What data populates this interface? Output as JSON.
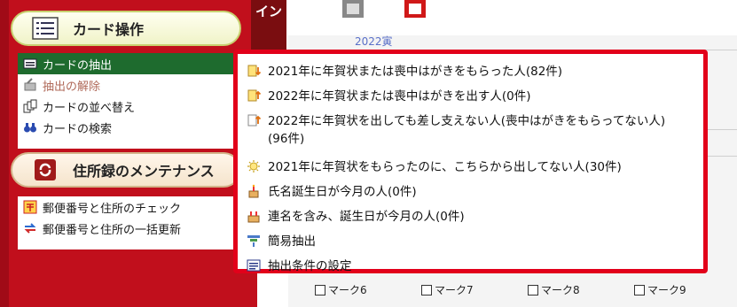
{
  "sidebar": {
    "vertical_tab": "イン",
    "card_ops": {
      "title": "カード操作",
      "items": [
        {
          "label": "カードの抽出"
        },
        {
          "label": "抽出の解除"
        },
        {
          "label": "カードの並べ替え"
        },
        {
          "label": "カードの検索"
        }
      ]
    },
    "maintenance": {
      "title": "住所録のメンテナンス",
      "items": [
        {
          "label": "郵便番号と住所のチェック"
        },
        {
          "label": "郵便番号と住所の一括更新"
        }
      ]
    }
  },
  "main": {
    "year_label": "2022寅",
    "marks": [
      "マーク6",
      "マーク7",
      "マーク8",
      "マーク9"
    ]
  },
  "popup": {
    "items": [
      {
        "label": "2021年に年賀状または喪中はがきをもらった人(82件)",
        "icon": "card-arrow-down-icon"
      },
      {
        "label": "2022年に年賀状または喪中はがきを出す人(0件)",
        "icon": "card-arrow-up-icon"
      },
      {
        "label": "2022年に年賀状を出しても差し支えない人(喪中はがきをもらってない人)",
        "label2": "(96件)",
        "icon": "card-ok-icon"
      },
      {
        "label": "2021年に年賀状をもらったのに、こちらから出してない人(30件)",
        "icon": "bulb-icon"
      },
      {
        "label": "氏名誕生日が今月の人(0件)",
        "icon": "cake-icon"
      },
      {
        "label": "連名を含み、誕生日が今月の人(0件)",
        "icon": "cake-multi-icon"
      },
      {
        "label": "簡易抽出",
        "icon": "simple-filter-icon"
      },
      {
        "label": "抽出条件の設定",
        "icon": "list-settings-icon"
      }
    ]
  }
}
